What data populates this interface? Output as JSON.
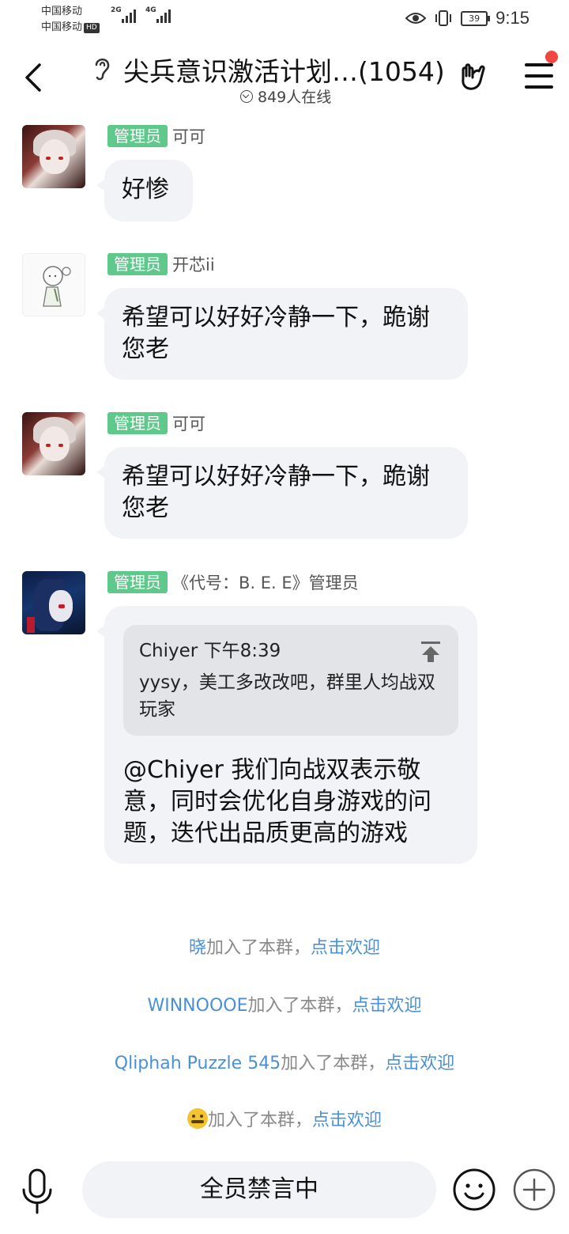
{
  "status_bar": {
    "carrier_1": "中国移动",
    "carrier_2": "中国移动",
    "hd": "HD",
    "net_1": "2G",
    "net_2": "4G",
    "battery": "39",
    "time": "9:15"
  },
  "header": {
    "title": "尖兵意识激活计划…(1054)",
    "online": "849人在线"
  },
  "messages": [
    {
      "badge": "管理员",
      "sender": "可可",
      "text": "好惨",
      "avatar": "red-haired-anime-avatar"
    },
    {
      "badge": "管理员",
      "sender": "开芯ii",
      "text": "希望可以好好冷静一下，跪谢您老",
      "avatar": "sketch-avatar"
    },
    {
      "badge": "管理员",
      "sender": "可可",
      "text": "希望可以好好冷静一下，跪谢您老",
      "avatar": "red-haired-anime-avatar"
    },
    {
      "badge": "管理员",
      "sender": "《代号：B. E. E》管理员",
      "avatar": "blue-haired-anime-avatar",
      "quote": {
        "author": "Chiyer",
        "time": "下午8:39",
        "text": "yysy，美工多改改吧，群里人均战双玩家"
      },
      "text": " @Chiyer 我们向战双表示敬意，同时会优化自身游戏的问题，迭代出品质更高的游戏"
    }
  ],
  "notices": [
    {
      "name": "晓",
      "text": "加入了本群，",
      "link": "点击欢迎"
    },
    {
      "name": "WINNOOOE",
      "text": "加入了本群，",
      "link": "点击欢迎"
    },
    {
      "name": "Qliphah Puzzle 545",
      "text": "加入了本群，",
      "link": "点击欢迎"
    },
    {
      "name": "",
      "text": "加入了本群，",
      "link": "点击欢迎"
    }
  ],
  "bottom_bar": {
    "input_text": "全员禁言中"
  },
  "colors": {
    "admin_badge": "#5fc98b",
    "link": "#4a90d9",
    "bubble": "#f2f3f7",
    "notification_dot": "#f0483e"
  }
}
